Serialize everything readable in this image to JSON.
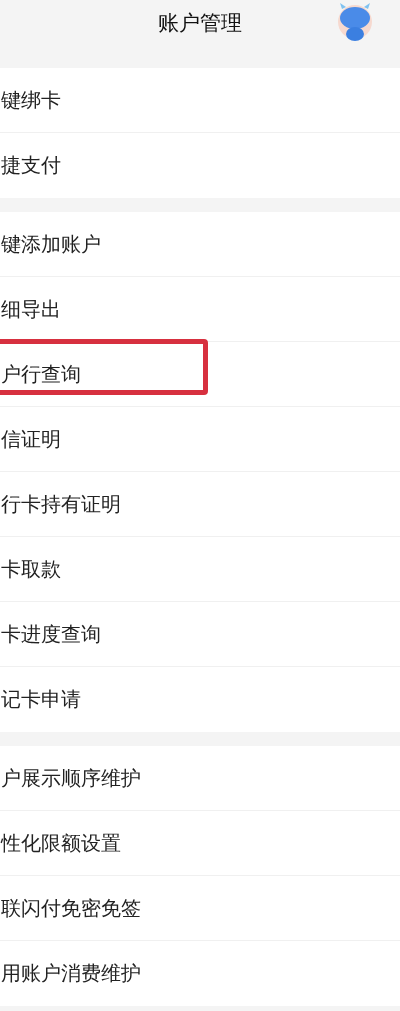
{
  "header": {
    "title": "账户管理"
  },
  "groups": [
    {
      "items": [
        {
          "label": "键绑卡",
          "highlighted": false
        },
        {
          "label": "捷支付",
          "highlighted": false
        }
      ]
    },
    {
      "items": [
        {
          "label": "键添加账户",
          "highlighted": false
        },
        {
          "label": "细导出",
          "highlighted": false
        },
        {
          "label": "户行查询",
          "highlighted": true
        },
        {
          "label": "信证明",
          "highlighted": false
        },
        {
          "label": "行卡持有证明",
          "highlighted": false
        },
        {
          "label": "卡取款",
          "highlighted": false
        },
        {
          "label": "卡进度查询",
          "highlighted": false
        },
        {
          "label": "记卡申请",
          "highlighted": false
        }
      ]
    },
    {
      "items": [
        {
          "label": "户展示顺序维护",
          "highlighted": false
        },
        {
          "label": "性化限额设置",
          "highlighted": false
        },
        {
          "label": "联闪付免密免签",
          "highlighted": false
        },
        {
          "label": "用账户消费维护",
          "highlighted": false
        }
      ]
    }
  ]
}
